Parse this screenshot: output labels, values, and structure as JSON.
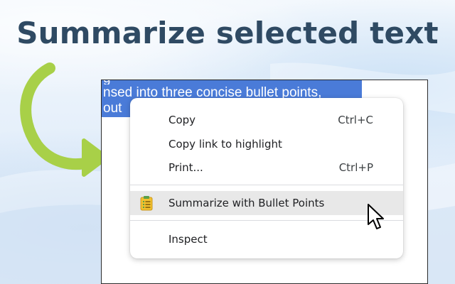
{
  "headline": "Summarize selected text",
  "page": {
    "selected_lines": [
      "g",
      "nsed into three concise bullet points,",
      "out"
    ]
  },
  "context_menu": {
    "items": [
      {
        "label": "Copy",
        "shortcut": "Ctrl+C"
      },
      {
        "label": "Copy link to highlight",
        "shortcut": ""
      },
      {
        "label": "Print...",
        "shortcut": "Ctrl+P"
      },
      {
        "label": "Summarize with Bullet Points",
        "shortcut": "",
        "icon": "clipboard-list-icon",
        "highlighted": true
      },
      {
        "label": "Inspect",
        "shortcut": ""
      }
    ]
  },
  "colors": {
    "headline": "#2f4a63",
    "selection": "#4a7bd8",
    "arrow": "#a8d048",
    "menu_hover": "#e8e8e8"
  }
}
